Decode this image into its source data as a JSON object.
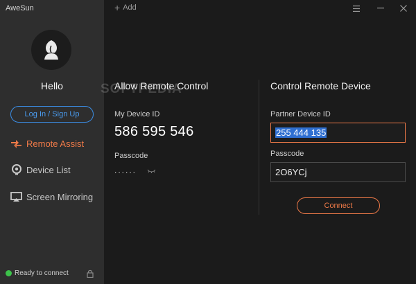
{
  "app": {
    "title": "AweSun"
  },
  "sidebar": {
    "greeting": "Hello",
    "login_label": "Log In / Sign Up",
    "items": [
      {
        "label": "Remote Assist",
        "icon": "remote-assist-icon",
        "active": true
      },
      {
        "label": "Device List",
        "icon": "device-list-icon",
        "active": false
      },
      {
        "label": "Screen Mirroring",
        "icon": "screen-mirroring-icon",
        "active": false
      }
    ],
    "status": "Ready to connect"
  },
  "topbar": {
    "add_label": "Add"
  },
  "allow": {
    "title": "Allow Remote Control",
    "device_id_label": "My Device ID",
    "device_id": "586 595 546",
    "passcode_label": "Passcode",
    "passcode_masked": "......"
  },
  "control": {
    "title": "Control Remote Device",
    "partner_label": "Partner Device ID",
    "partner_value": "255 444 135",
    "passcode_label": "Passcode",
    "passcode_value": "2O6YCj",
    "connect_label": "Connect"
  },
  "watermark": "SOFTPEDIA",
  "colors": {
    "accent": "#f07a48",
    "link": "#3b8ee6",
    "status_ok": "#3cc24a"
  }
}
